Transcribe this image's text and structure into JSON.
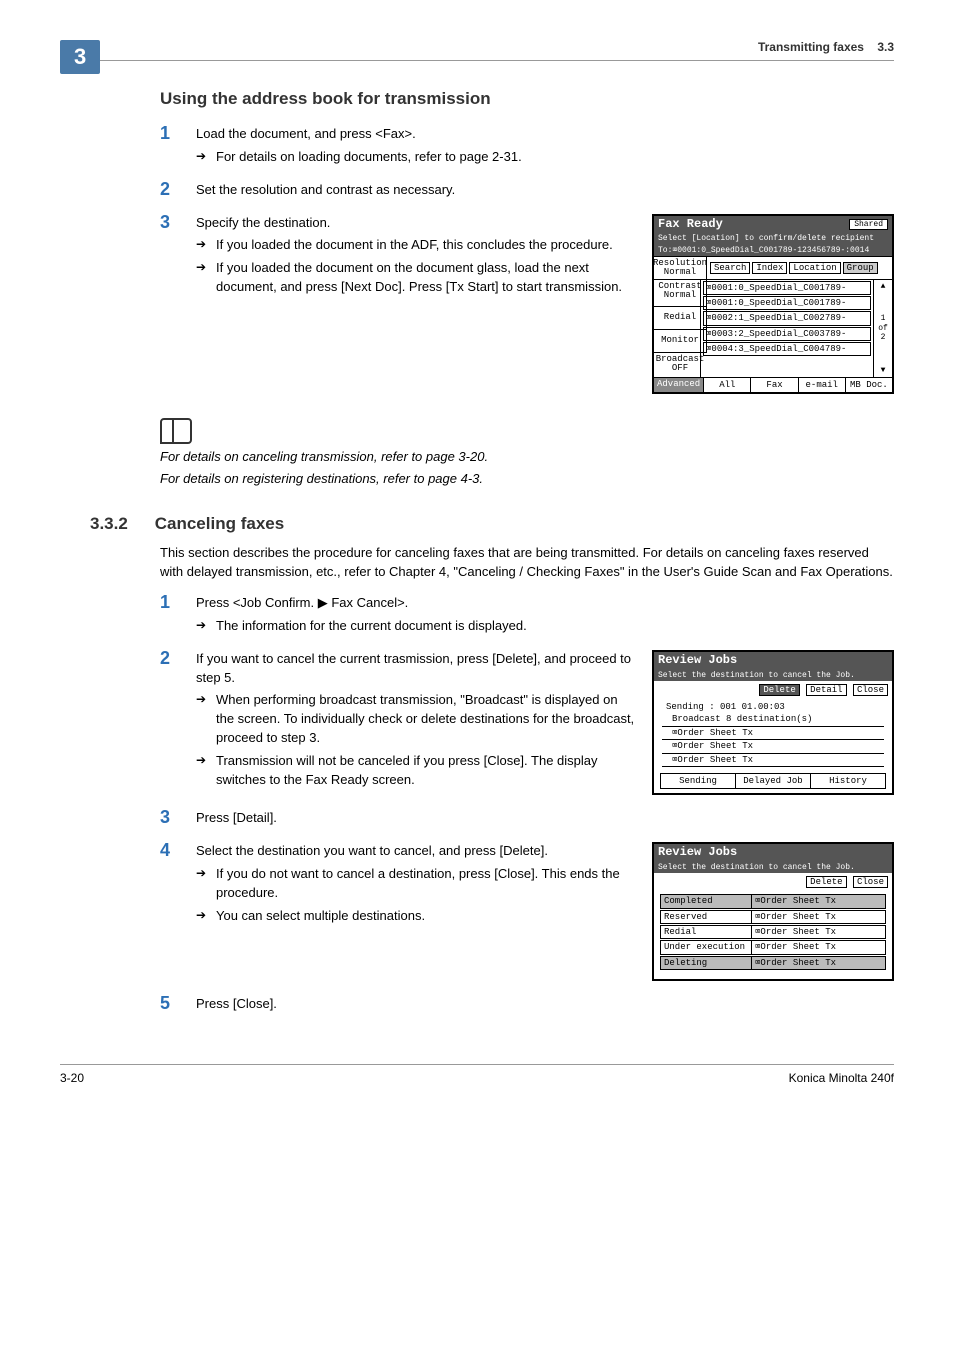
{
  "header": {
    "title": "Transmitting faxes",
    "section": "3.3",
    "badge": "3"
  },
  "h1": "Using the address book for transmission",
  "s1": {
    "step1": "Load the document, and press <Fax>.",
    "step1a": "For details on loading documents, refer to page 2-31.",
    "step2": "Set the resolution and contrast as necessary.",
    "step3": "Specify the destination.",
    "step3a": "If you loaded the document in the ADF, this concludes the procedure.",
    "step3b": "If you loaded the document on the document glass, load the next document, and press [Next Doc]. Press [Tx Start] to start transmission."
  },
  "note1": "For details on canceling transmission, refer to page 3-20.",
  "note2": "For details on registering destinations, refer to page 4-3.",
  "h2num": "3.3.2",
  "h2": "Canceling faxes",
  "intro": "This section describes the procedure for canceling faxes that are being transmitted. For details on canceling faxes reserved with delayed transmission, etc., refer to Chapter 4, \"Canceling / Checking Faxes\" in the User's Guide Scan and Fax Operations.",
  "s2": {
    "step1": "Press <Job Confirm. ▶ Fax Cancel>.",
    "step1a": "The information for the current document is displayed.",
    "step2": "If you want to cancel the current trasmission, press [Delete], and proceed to step 5.",
    "step2a": "When performing broadcast transmission, \"Broadcast\" is displayed on the screen. To individually check or delete destinations for the broadcast, proceed to step 3.",
    "step2b": "Transmission will not be canceled if you press [Close]. The display switches to the Fax Ready screen.",
    "step3": "Press [Detail].",
    "step4": "Select the destination you want to cancel, and press [Delete].",
    "step4a": "If you do not want to cancel a destination, press [Close]. This ends the procedure.",
    "step4b": "You can select multiple destinations.",
    "step5": "Press [Close]."
  },
  "screen1": {
    "title": "Fax Ready",
    "shared": "Shared",
    "sub1": "Select [Location] to confirm/delete recipient",
    "sub2": "To:⌧0001:0_SpeedDial_C001789-123456789-:0014",
    "side": {
      "res": "Resolution",
      "resv": "Normal",
      "con": "Contrast",
      "conv": "Normal",
      "redial": "Redial",
      "monitor": "Monitor",
      "bcast": "Broadcast",
      "bcastv": "OFF",
      "adv": "Advanced"
    },
    "tabs": {
      "search": "Search",
      "index": "Index",
      "location": "Location",
      "group": "Group"
    },
    "entries": [
      "⌧0001:0_SpeedDial_C001789-",
      "⌧0001:0_SpeedDial_C001789-",
      "⌧0002:1_SpeedDial_C002789-",
      "⌧0003:2_SpeedDial_C003789-",
      "⌧0004:3_SpeedDial_C004789-"
    ],
    "page": "1\nof\n2",
    "btabs": {
      "all": "All",
      "fax": "Fax",
      "email": "e-mail",
      "mbdoc": "MB Doc."
    }
  },
  "screen2": {
    "title": "Review Jobs",
    "sub": "Select the destination to cancel the Job.",
    "btns": {
      "delete": "Delete",
      "detail": "Detail",
      "close": "Close"
    },
    "head": "Sending : 001 01.00:03",
    "lines": [
      "Broadcast 8 destination(s)",
      "⌧Order Sheet Tx",
      "⌧Order Sheet Tx",
      "⌧Order Sheet Tx"
    ],
    "tabs": {
      "sending": "Sending",
      "delayed": "Delayed Job",
      "history": "History"
    }
  },
  "screen3": {
    "title": "Review Jobs",
    "sub": "Select the destination to cancel the Job.",
    "btns": {
      "delete": "Delete",
      "close": "Close"
    },
    "rows": [
      {
        "k": "Completed",
        "v": "⌧Order Sheet Tx",
        "shade": true
      },
      {
        "k": "Reserved",
        "v": "⌧Order Sheet Tx",
        "shade": false
      },
      {
        "k": "Redial",
        "v": "⌧Order Sheet Tx",
        "shade": false
      },
      {
        "k": "Under execution",
        "v": "⌧Order Sheet Tx",
        "shade": false
      },
      {
        "k": "Deleting",
        "v": "⌧Order Sheet Tx",
        "shade": true
      }
    ]
  },
  "footer": {
    "left": "3-20",
    "right": "Konica Minolta 240f"
  }
}
